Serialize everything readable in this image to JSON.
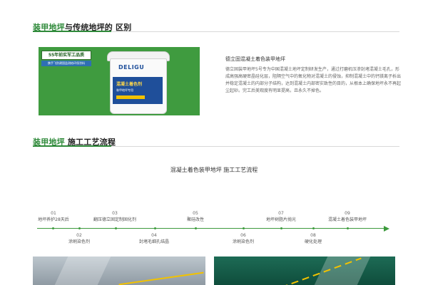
{
  "section1": {
    "title_green": "装甲地坪",
    "title_rest": "与传统地坪的 区别"
  },
  "banner": {
    "badge": "55年前实军工品质",
    "badge_sub": "携手飞防建国监测结环保涂料",
    "brand": "DELIGU",
    "product_name": "混凝土着色剂",
    "product_sub": "装甲地坪专用",
    "colors": {
      "background": "#3f9b3f",
      "label": "#1f4f9a",
      "accent": "#f2c200"
    }
  },
  "description": {
    "title": "德立固混凝土着色装甲地坪",
    "text": "德立固装甲地坪5号专为中国混凝土地坪定制研发生产，通过打磨机压渗封堵混凝土毛孔，形成高强高硬密晶硅化层，阻隔空气中的氧化物对混凝土的侵蚀，抑制混凝土中的钙镁离子析出并稳定混凝土的内部分子结构，达到混凝土内部密实致性的目的，从根本上确保地坪永不再起尘起砂。完工后美观度有明显提高，且永久不掉色。"
  },
  "section2": {
    "title_green": "装甲地坪",
    "title_rest": " 施工工艺流程"
  },
  "flow": {
    "title": "混凝土着色装甲地坪 施工工艺流程",
    "steps_above": [
      {
        "num": "01",
        "label": "地坪养护28天后"
      },
      {
        "num": "03",
        "label": "翻压德立固定制固化剂"
      },
      {
        "num": "05",
        "label": "聚硅改性"
      },
      {
        "num": "07",
        "label": "地坪树脂片抛光"
      },
      {
        "num": "09",
        "label": "混凝土着色装甲地坪"
      }
    ],
    "steps_below": [
      {
        "num": "02",
        "label": "涂刷染色剂"
      },
      {
        "num": "04",
        "label": "封堵毛细孔结晶"
      },
      {
        "num": "06",
        "label": "涂刷染色剂"
      },
      {
        "num": "08",
        "label": "硬化处理"
      }
    ],
    "line_color": "#3c9a3c"
  }
}
